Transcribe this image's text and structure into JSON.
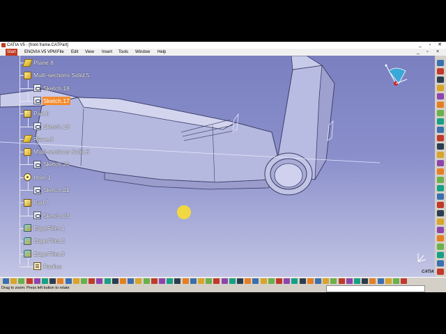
{
  "window": {
    "title": "CATIA V5 - [front frame.CATPart]",
    "controls": [
      "_",
      "▫",
      "✕"
    ]
  },
  "menu": {
    "items": [
      "Start",
      "ENOVIA V5 VPM",
      "File",
      "Edit",
      "View",
      "Insert",
      "Tools",
      "Window",
      "Help"
    ],
    "right_controls": [
      "_",
      "▫",
      "×"
    ]
  },
  "tree": {
    "nodes": [
      {
        "label": "Plane.8",
        "icon": "plane-icon",
        "highlighted": false
      },
      {
        "label": "Multi-sections Solid.5",
        "icon": "multi-sections-solid-icon",
        "highlighted": false
      },
      {
        "label": "Sketch.18",
        "icon": "sketch-icon",
        "highlighted": false
      },
      {
        "label": "Sketch.17",
        "icon": "sketch-icon",
        "highlighted": true
      },
      {
        "label": "Pad.6",
        "icon": "pad-icon",
        "highlighted": false
      },
      {
        "label": "Sketch.19",
        "icon": "sketch-icon",
        "highlighted": false
      },
      {
        "label": "Plane.9",
        "icon": "plane-icon",
        "highlighted": false
      },
      {
        "label": "Multi-sections Solid.6",
        "icon": "multi-sections-solid-icon",
        "highlighted": false
      },
      {
        "label": "Sketch.20",
        "icon": "sketch-icon",
        "highlighted": false
      },
      {
        "label": "Hole.1",
        "icon": "hole-icon",
        "highlighted": false
      },
      {
        "label": "Sketch.21",
        "icon": "sketch-icon",
        "highlighted": false
      },
      {
        "label": "Pad.7",
        "icon": "pad-icon",
        "highlighted": false
      },
      {
        "label": "Sketch.23",
        "icon": "sketch-icon",
        "highlighted": false
      },
      {
        "label": "EdgeFillet.1",
        "icon": "edge-fillet-icon",
        "highlighted": false
      },
      {
        "label": "EdgeFillet.2",
        "icon": "edge-fillet-icon",
        "highlighted": false
      },
      {
        "label": "EdgeFillet.3",
        "icon": "edge-fillet-icon",
        "highlighted": false
      },
      {
        "label": "Radius",
        "icon": "radius-icon",
        "highlighted": false
      }
    ]
  },
  "viewport": {
    "background_top": "#7a7fc0",
    "background_bottom": "#c2c5e4",
    "part_color": "#b8bbe0",
    "highlight_color": "#f58b2c",
    "logo_text": "CATIA"
  },
  "status": {
    "message": "Drag to zoom: Press left button to rotate"
  }
}
